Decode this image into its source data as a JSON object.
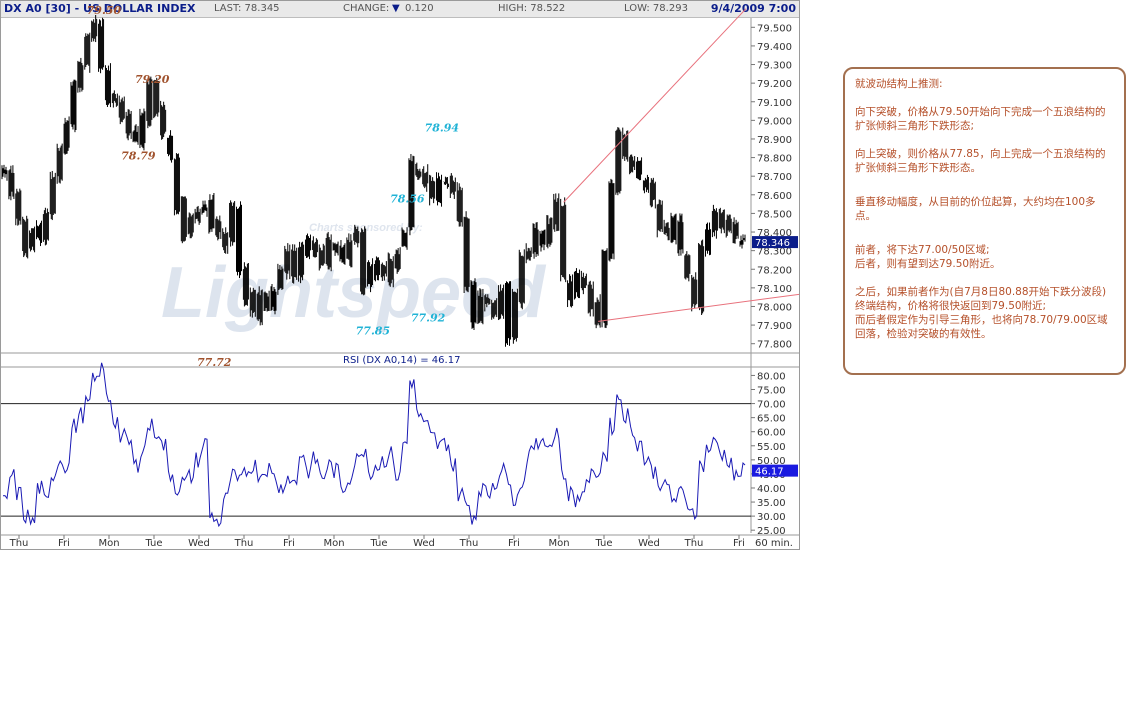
{
  "header": {
    "symbol": "DX A0 [30] - US DOLLAR INDEX",
    "last": "LAST: 78.345",
    "change_label": "CHANGE:",
    "change_value": "0.120",
    "high": "HIGH: 78.522",
    "low": "LOW: 78.293",
    "datetime": "9/4/2009 7:00"
  },
  "colors": {
    "price_bar": "#000000",
    "rsi_line": "#1a1ab4",
    "wave_label_brown": "#a0522d",
    "wave_label_cyan": "#21b3d6",
    "trendline": "#e8717c",
    "current_tag": "#0b1d8a",
    "note_border": "#a3704f",
    "note_text": "#b5502a"
  },
  "watermark": {
    "sponsor": "Charts sponsored by:",
    "brand": "Lightspeed"
  },
  "chart_data": [
    {
      "type": "bar",
      "series": [
        {
          "values": [
            78.72,
            78.6,
            78.47,
            78.32,
            78.42,
            78.35,
            78.5,
            78.68,
            78.85,
            78.99,
            79.18,
            79.32,
            79.45,
            79.5,
            79.28,
            79.12,
            79.1,
            79.0,
            78.95,
            78.88,
            79.02,
            79.18,
            79.06,
            78.92,
            78.79,
            78.55,
            78.4,
            78.48,
            78.52,
            78.55,
            78.44,
            78.4,
            78.35,
            78.55,
            78.2,
            78.05,
            77.95,
            78.05,
            78.0,
            78.1,
            78.2,
            78.28,
            78.15,
            78.3,
            78.35,
            78.3,
            78.25,
            78.35,
            78.3,
            78.25,
            78.35,
            78.4,
            78.1,
            78.22,
            78.18,
            78.15,
            78.23,
            78.3,
            78.4,
            78.75,
            78.71,
            78.68,
            78.6,
            78.66,
            78.65,
            78.6,
            78.46,
            78.12,
            77.92,
            78.05,
            78.0,
            77.95,
            78.1,
            77.85,
            78.05,
            78.25,
            78.32,
            78.4,
            78.35,
            78.45,
            78.56,
            78.15,
            78.05,
            78.15,
            78.1,
            78.0,
            77.92,
            78.28,
            78.65,
            78.94,
            78.8,
            78.75,
            78.7,
            78.65,
            78.55,
            78.42,
            78.38,
            78.45,
            78.3,
            78.15,
            78.0,
            78.32,
            78.4,
            78.5,
            78.45,
            78.42,
            78.38,
            78.35
          ]
        }
      ],
      "categories": [
        "Thu",
        "Fri",
        "Mon",
        "Tue",
        "Wed",
        "Thu",
        "Fri",
        "Mon",
        "Tue",
        "Wed",
        "Thu",
        "Fri",
        "Mon",
        "Tue",
        "Wed",
        "Thu",
        "Fri"
      ],
      "y_ticks": [
        "79.500",
        "79.400",
        "79.300",
        "79.200",
        "79.100",
        "79.000",
        "78.900",
        "78.800",
        "78.700",
        "78.600",
        "78.500",
        "78.400",
        "78.300",
        "78.200",
        "78.100",
        "78.000",
        "77.900",
        "77.800"
      ],
      "ylim": [
        77.75,
        79.55
      ],
      "current_value": "78.346",
      "wave_labels": [
        {
          "text": "79.50",
          "x": 13,
          "y": 79.5,
          "color": "brown"
        },
        {
          "text": "79.20",
          "x": 20,
          "y": 79.2,
          "color": "brown"
        },
        {
          "text": "78.79",
          "x": 18,
          "y": 78.79,
          "color": "brown"
        },
        {
          "text": "77.72",
          "x": 29,
          "y": 77.72,
          "color": "brown"
        },
        {
          "text": "78.56",
          "x": 57,
          "y": 78.56,
          "color": "cyan"
        },
        {
          "text": "78.94",
          "x": 62,
          "y": 78.94,
          "color": "cyan"
        },
        {
          "text": "77.85",
          "x": 52,
          "y": 77.85,
          "color": "cyan"
        },
        {
          "text": "77.92",
          "x": 60,
          "y": 77.92,
          "color": "cyan"
        }
      ],
      "x_axis_unit": "60 min."
    },
    {
      "type": "line",
      "title": "RSI (DX A0,14) = 46.17",
      "series": [
        {
          "values": [
            35,
            44,
            38,
            30,
            28,
            40,
            35,
            45,
            50,
            48,
            62,
            66,
            70,
            78,
            82,
            72,
            64,
            58,
            56,
            48,
            54,
            62,
            60,
            55,
            45,
            40,
            42,
            44,
            50,
            56,
            30,
            28,
            36,
            44,
            42,
            46,
            48,
            45,
            47,
            44,
            40,
            44,
            42,
            52,
            46,
            50,
            44,
            48,
            46,
            40,
            44,
            50,
            54,
            46,
            48,
            50,
            52,
            44,
            56,
            78,
            66,
            62,
            58,
            55,
            56,
            48,
            38,
            34,
            30,
            40,
            38,
            42,
            46,
            44,
            36,
            42,
            52,
            55,
            58,
            55,
            60,
            44,
            38,
            36,
            40,
            44,
            46,
            52,
            62,
            72,
            66,
            60,
            56,
            50,
            46,
            42,
            40,
            36,
            38,
            34,
            32,
            48,
            54,
            56,
            52,
            50,
            44,
            46
          ]
        }
      ],
      "y_ticks": [
        "80.00",
        "75.00",
        "70.00",
        "65.00",
        "60.00",
        "55.00",
        "50.00",
        "45.00",
        "40.00",
        "35.00",
        "30.00",
        "25.00"
      ],
      "ylim": [
        24,
        83
      ],
      "reference_lines": [
        70,
        30
      ],
      "current_value": "46.17"
    }
  ],
  "note": {
    "title": "就波动结构上推测:",
    "p1": "向下突破，价格从79.50开始向下完成一个五浪结构的扩张倾斜三角形下跌形态;",
    "p2": "向上突破，则价格从77.85，向上完成一个五浪结构的扩张倾斜三角形下跌形态。",
    "p3": "垂直移动幅度，从目前的价位起算，大约均在100多点。",
    "p4": "前者，将下达77.00/50区域;\n后者，则有望到达79.50附近。",
    "p5": "之后，如果前者作为(自7月8日80.88开始下跌分波段)终端结构，价格将很快返回到79.50附近;\n而后者假定作为引导三角形，也将向78.70/79.00区域回落，检验对突破的有效性。"
  }
}
